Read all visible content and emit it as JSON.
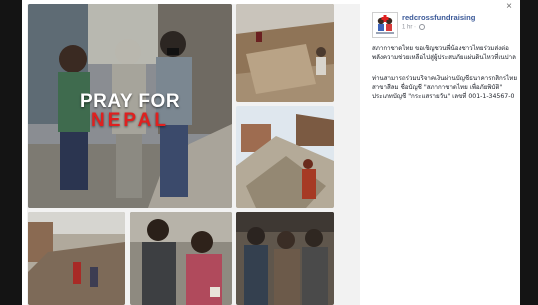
{
  "overlay": {
    "line1": "PRAY FOR",
    "line2": "NEPAL"
  },
  "post": {
    "page_name": "redcrossfundraising",
    "time": "1 hr",
    "paragraph1": "สภากาชาดไทย ขอเชิญชวนพี่น้องชาวไทยร่วมส่งต่อพลังความช่วยเหลือไปสู่ผู้ประสบภัยแผ่นดินไหวที่เนปาล",
    "paragraph2": "ท่านสามารถร่วมบริจาคเงินผ่านบัญชีธนาคารกสิกรไทย สาขาสีลม ชื่อบัญชี \"สภากาชาดไทย เพื่อภัยพิบัติ\" ประเภทบัญชี \"กระแสรายวัน\" เลขที่ 001-1-34567-0"
  },
  "icons": {
    "close": "×",
    "avatar": "red-cross-children-logo",
    "privacy": "globe-icon"
  },
  "colors": {
    "backdrop": "#141414",
    "link": "#3b5998",
    "accent_red": "#e0201f"
  }
}
